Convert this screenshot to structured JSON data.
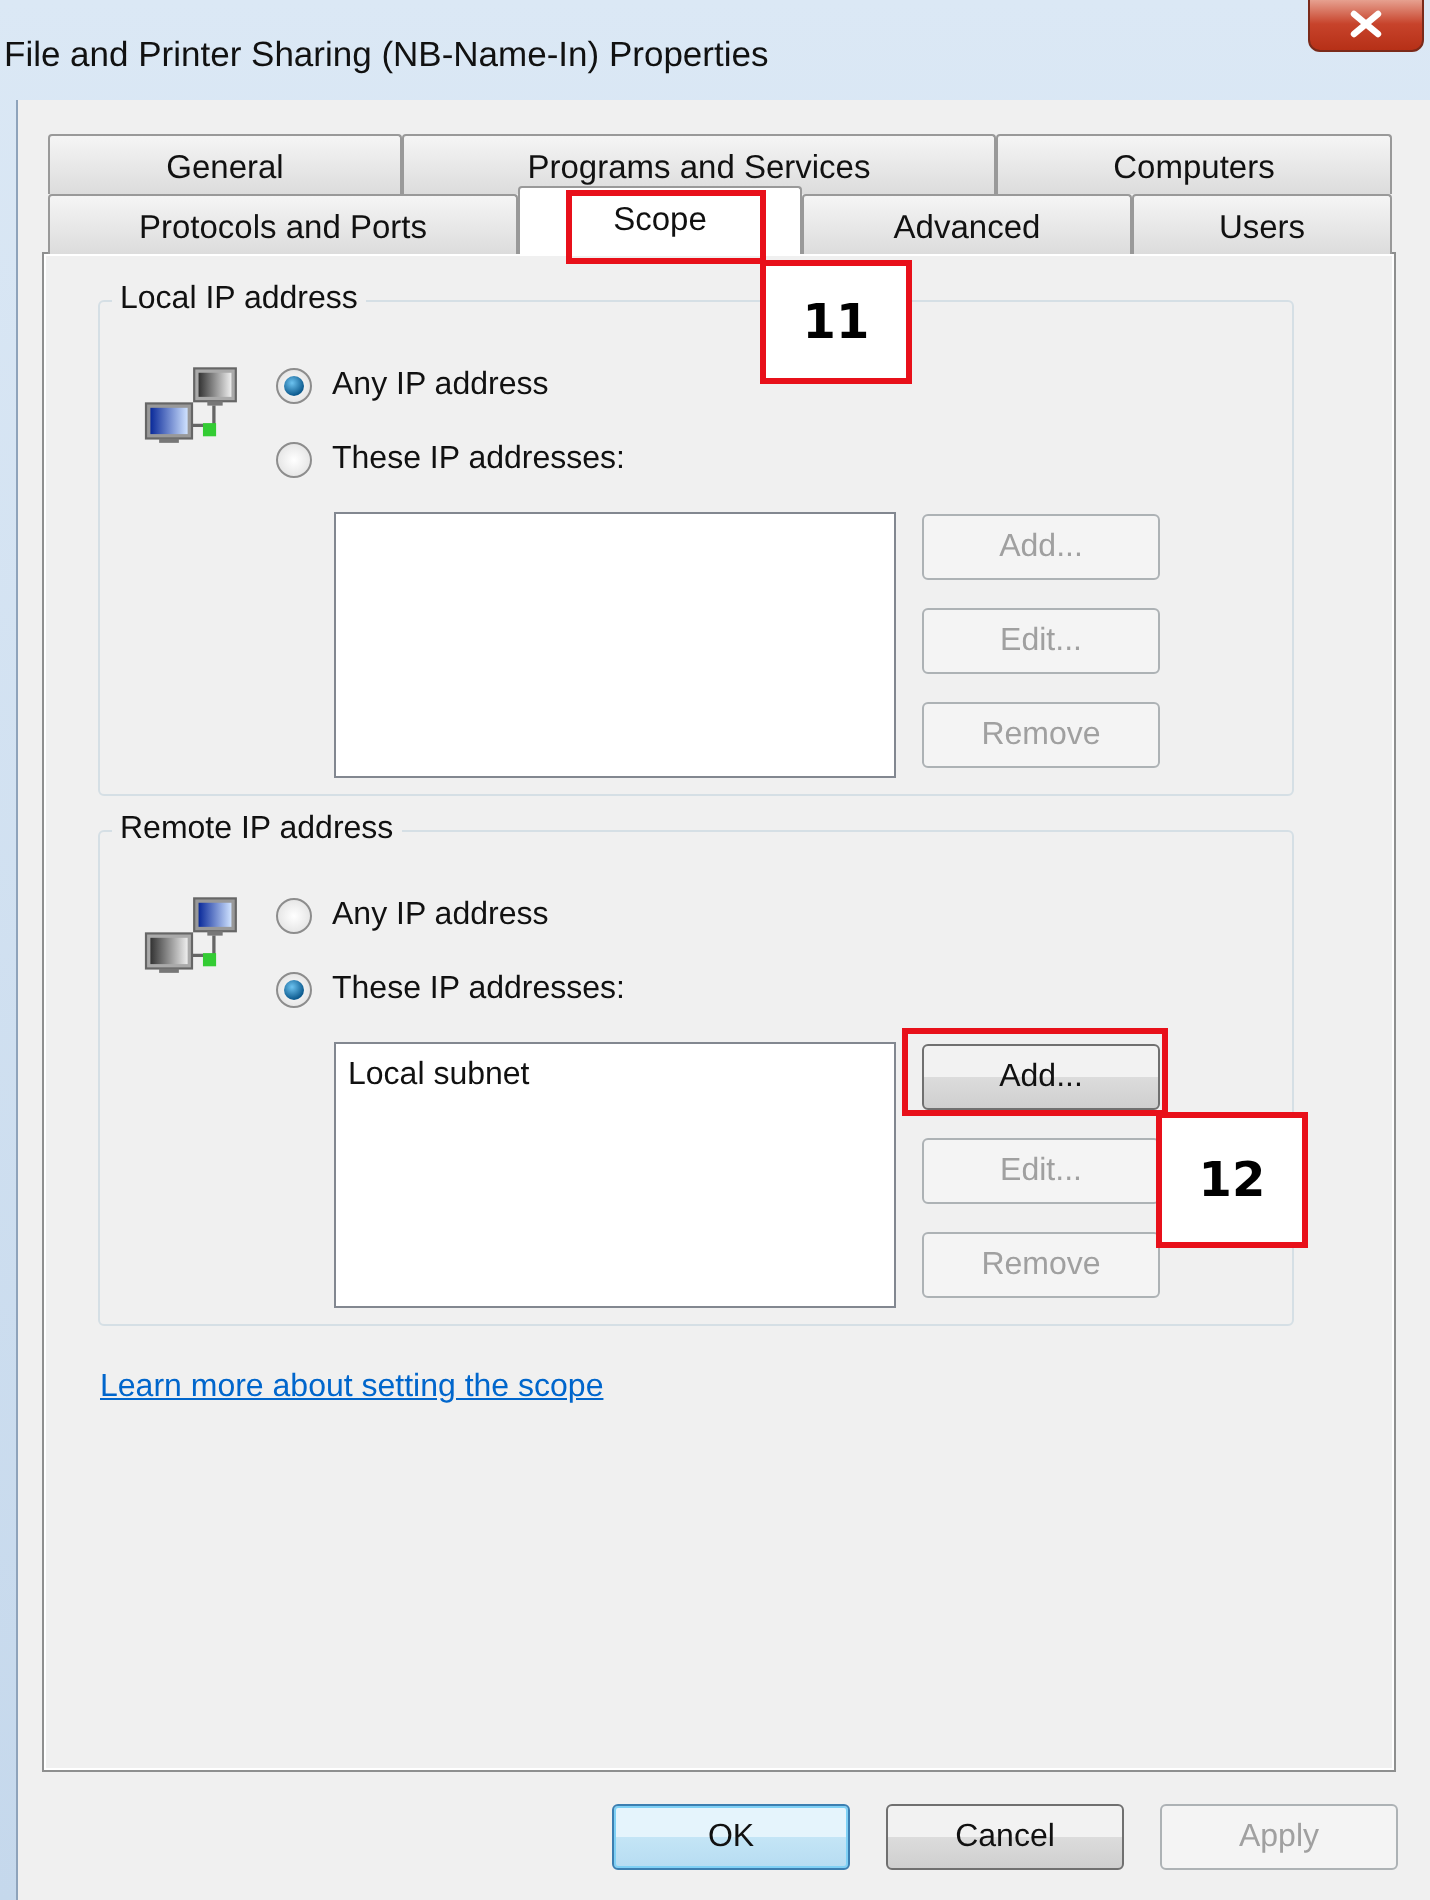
{
  "window": {
    "title": "File and Printer Sharing (NB-Name-In) Properties"
  },
  "tab_rows": [
    [
      {
        "label": "General",
        "selected": false
      },
      {
        "label": "Programs and Services",
        "selected": false
      },
      {
        "label": "Computers",
        "selected": false
      }
    ],
    [
      {
        "label": "Protocols and Ports",
        "selected": false
      },
      {
        "label": "Scope",
        "selected": true
      },
      {
        "label": "Advanced",
        "selected": false
      },
      {
        "label": "Users",
        "selected": false
      }
    ]
  ],
  "groups": [
    {
      "title": "Local IP address",
      "options": [
        {
          "label": "Any IP address",
          "selected": true
        },
        {
          "label": "These IP addresses:",
          "selected": false
        }
      ],
      "buttons": [
        {
          "label": "Add...",
          "disabled": true
        },
        {
          "label": "Edit...",
          "disabled": true
        },
        {
          "label": "Remove",
          "disabled": true
        }
      ]
    },
    {
      "title": "Remote IP address",
      "options": [
        {
          "label": "Any IP address",
          "selected": false
        },
        {
          "label": "These IP addresses:",
          "selected": true
        }
      ],
      "list_items": [
        "Local subnet"
      ],
      "buttons": [
        {
          "label": "Add...",
          "disabled": false
        },
        {
          "label": "Edit...",
          "disabled": true
        },
        {
          "label": "Remove",
          "disabled": true
        }
      ]
    }
  ],
  "link": "Learn more about setting the scope",
  "dialog_buttons": [
    {
      "label": "OK",
      "default": true,
      "disabled": false
    },
    {
      "label": "Cancel",
      "default": false,
      "disabled": false
    },
    {
      "label": "Apply",
      "default": false,
      "disabled": true
    }
  ],
  "callouts": [
    {
      "label": "11"
    },
    {
      "label": "12"
    }
  ]
}
